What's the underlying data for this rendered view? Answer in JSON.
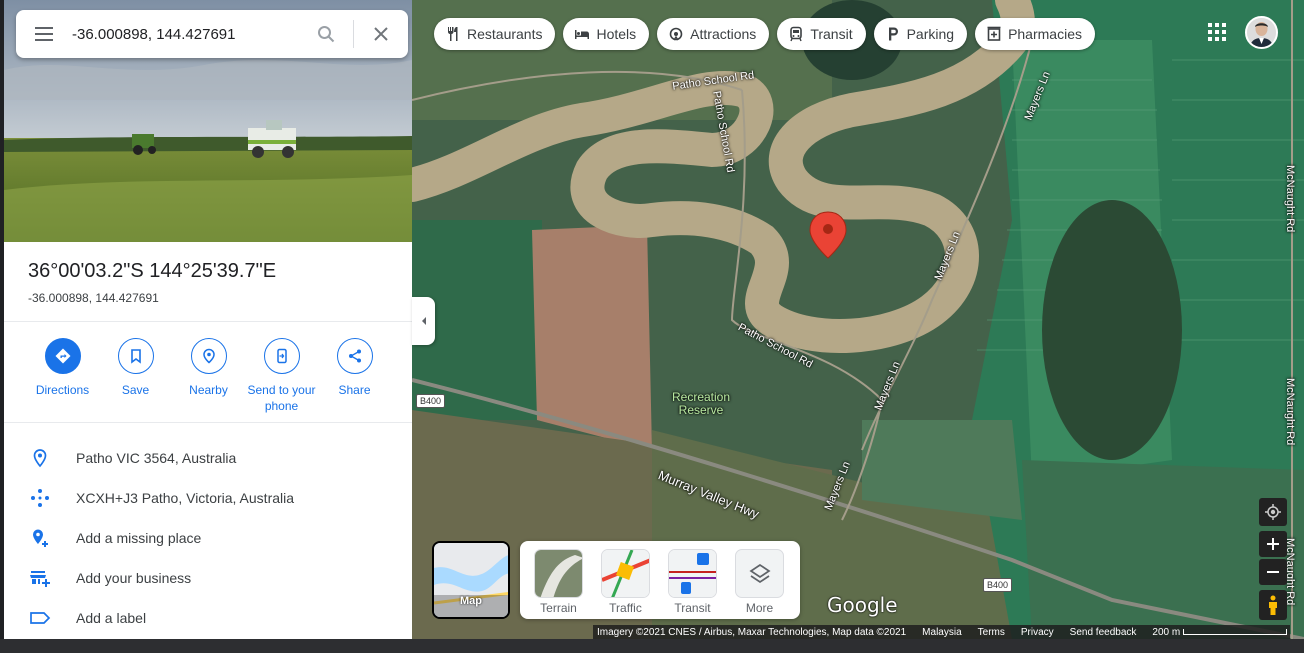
{
  "search": {
    "value": "-36.000898, 144.427691"
  },
  "place": {
    "title": "36°00'03.2\"S 144°25'39.7\"E",
    "subtitle": "-36.000898, 144.427691"
  },
  "actions": [
    {
      "label": "Directions",
      "icon": "directions-icon"
    },
    {
      "label": "Save",
      "icon": "bookmark-icon"
    },
    {
      "label": "Nearby",
      "icon": "nearby-icon"
    },
    {
      "label": "Send to your phone",
      "icon": "phone-icon"
    },
    {
      "label": "Share",
      "icon": "share-icon"
    }
  ],
  "info": [
    {
      "text": "Patho VIC 3564, Australia",
      "icon": "location-pin-icon"
    },
    {
      "text": "XCXH+J3 Patho, Victoria, Australia",
      "icon": "plus-code-icon"
    },
    {
      "text": "Add a missing place",
      "icon": "add-place-icon"
    },
    {
      "text": "Add your business",
      "icon": "add-business-icon"
    },
    {
      "text": "Add a label",
      "icon": "label-icon"
    }
  ],
  "chips": [
    {
      "label": "Restaurants",
      "icon": "restaurant-icon"
    },
    {
      "label": "Hotels",
      "icon": "hotel-icon"
    },
    {
      "label": "Attractions",
      "icon": "attractions-icon"
    },
    {
      "label": "Transit",
      "icon": "transit-icon"
    },
    {
      "label": "Parking",
      "icon": "parking-icon"
    },
    {
      "label": "Pharmacies",
      "icon": "pharmacy-icon"
    }
  ],
  "map_labels": {
    "road1": "Patho School Rd",
    "road2": "Patho School Rd",
    "road3": "Patho School Rd",
    "mayers1": "Mayers Ln",
    "mayers2": "Mayers Ln",
    "mayers3": "Mayers Ln",
    "highway": "Murray Valley Hwy",
    "recreation": "Recreation Reserve",
    "b400a": "B400",
    "b400b": "B400",
    "mcnaught1": "McNaught Rd",
    "mcnaught2": "McNaught Rd",
    "mcnaught3": "McNaught Rd"
  },
  "layers": {
    "map_toggle": "Map",
    "items": [
      "Terrain",
      "Traffic",
      "Transit",
      "More"
    ]
  },
  "logo": "Google",
  "footer": {
    "imagery": "Imagery ©2021 CNES / Airbus, Maxar Technologies, Map data ©2021",
    "country": "Malaysia",
    "terms": "Terms",
    "privacy": "Privacy",
    "feedback": "Send feedback",
    "scale": "200 m"
  },
  "colors": {
    "accent": "#1a73e8",
    "pin": "#ea4335",
    "river": "#b5a888"
  }
}
